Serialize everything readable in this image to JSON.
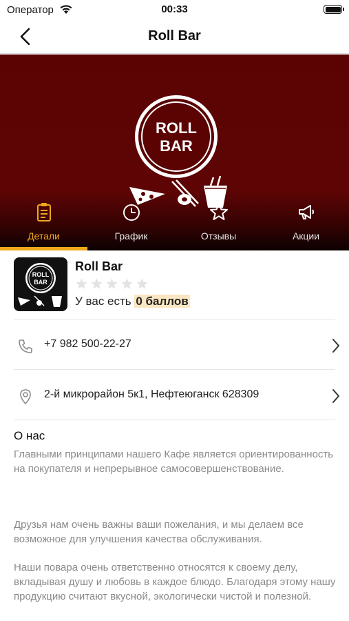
{
  "status_bar": {
    "carrier": "Оператор",
    "time": "00:33"
  },
  "nav": {
    "title": "Roll Bar"
  },
  "hero": {
    "logo_line1": "ROLL",
    "logo_line2": "BAR"
  },
  "tabs": [
    {
      "label": "Детали",
      "icon": "clipboard-icon",
      "active": true
    },
    {
      "label": "График",
      "icon": "clock-icon",
      "active": false
    },
    {
      "label": "Отзывы",
      "icon": "star-icon",
      "active": false
    },
    {
      "label": "Акции",
      "icon": "megaphone-icon",
      "active": false
    }
  ],
  "info": {
    "name": "Roll Bar",
    "rating": 0,
    "rating_max": 5,
    "points_prefix": "У вас есть",
    "points_value": "0 баллов",
    "logo_line1": "ROLL",
    "logo_line2": "BAR"
  },
  "contacts": {
    "phone": "+7 982 500-22-27",
    "address": "2-й микрорайон 5к1, Нефтеюганск 628309"
  },
  "about": {
    "title": "О нас",
    "paragraphs": [
      "Главными принципами нашего Кафе является ориентированность на покупателя и непрерывное самосовершенствование.",
      "Друзья нам очень важны ваши пожелания, и мы делаем все возможное для улучшения качества обслуживания.",
      "Наши повара очень ответственно относятся к своему делу, вкладывая душу и любовь в каждое блюдо. Благодаря этому нашу продукцию считают вкусной, экологически чистой и полезной."
    ]
  },
  "colors": {
    "accent": "#f0a81a",
    "hero_bg": "#5b0303",
    "highlight": "#fbe6c2"
  }
}
